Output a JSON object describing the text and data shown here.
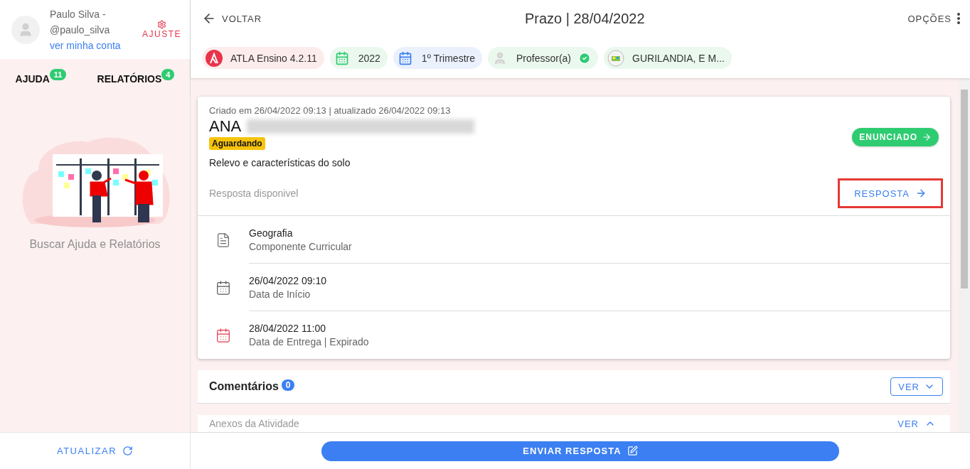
{
  "profile": {
    "name": "Paulo Silva -",
    "handle": "@paulo_silva",
    "account_link": "ver minha conta",
    "settings_label": "AJUSTE"
  },
  "sidebar": {
    "tabs": [
      {
        "label": "AJUDA",
        "count": "11"
      },
      {
        "label": "RELATÓRIOS",
        "count": "4"
      }
    ],
    "empty_text": "Buscar Ajuda e Relatórios",
    "refresh_button": "ATUALIZAR"
  },
  "header": {
    "back": "VOLTAR",
    "title": "Prazo | 28/04/2022",
    "options": "OPÇÕES"
  },
  "chips": [
    {
      "kind": "logo",
      "label": "ATLA Ensino 4.2.11",
      "color": "#fdecec"
    },
    {
      "kind": "calendar-green",
      "label": "2022",
      "color": "#eaf8ee"
    },
    {
      "kind": "calendar-blue",
      "label": "1º Trimestre",
      "color": "#eaf1fd"
    },
    {
      "kind": "person",
      "label": "Professor(a)",
      "color": "#eaf8ee",
      "verified": true
    },
    {
      "kind": "school",
      "label": "GURILANDIA, E M...",
      "color": "#eaf8ee"
    }
  ],
  "card": {
    "meta": "Criado em 26/04/2022 09:13 | atualizado 26/04/2022 09:13",
    "student": "ANA",
    "status": "Aguardando",
    "topic": "Relevo e características do solo",
    "statement_button": "ENUNCIADO",
    "answer_note": "Resposta disponivel",
    "answer_button": "RESPOSTA",
    "answer_highlighted": true,
    "details": [
      {
        "kind": "document",
        "value": "Geografia",
        "label": "Componente Curricular"
      },
      {
        "kind": "calendar",
        "value": "26/04/2022 09:10",
        "label": "Data de Início"
      },
      {
        "kind": "calendar-expired",
        "value": "28/04/2022 11:00",
        "label": "Data de Entrega | Expirado"
      }
    ]
  },
  "comments": {
    "title": "Comentários",
    "count": "0",
    "button": "VER"
  },
  "attachments": {
    "title": "Anexos da Atividade",
    "button": "VER"
  },
  "send_button": "ENVIAR RESPOSTA"
}
